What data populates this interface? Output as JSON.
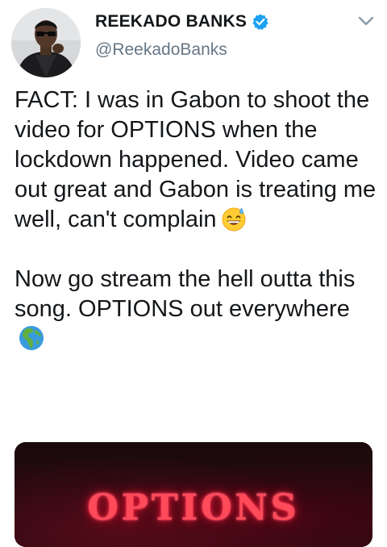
{
  "user": {
    "display_name": "REEKADO BANKS",
    "handle": "@ReekadoBanks",
    "verified": true,
    "avatar_icon": "avatar-photo",
    "verified_icon": "verified-badge-icon",
    "verified_color": "#1da1f2"
  },
  "menu": {
    "icon": "chevron-down-icon"
  },
  "tweet": {
    "paragraph_1": "FACT: I was in Gabon to shoot the video for OPTIONS when the lockdown happened. Video came out great and Gabon is treating me well, can't complain",
    "paragraph_1_emoji": "grinning-face-with-sweat-emoji",
    "paragraph_2": "Now go stream the hell outta this song. OPTIONS out everywhere",
    "paragraph_2_emoji": "globe-showing-europe-africa-emoji"
  },
  "media": {
    "title": "OPTIONS",
    "title_color": "#ff4a5a",
    "background_color": "#160707"
  },
  "colors": {
    "text": "#14171a",
    "secondary_text": "#657786"
  }
}
